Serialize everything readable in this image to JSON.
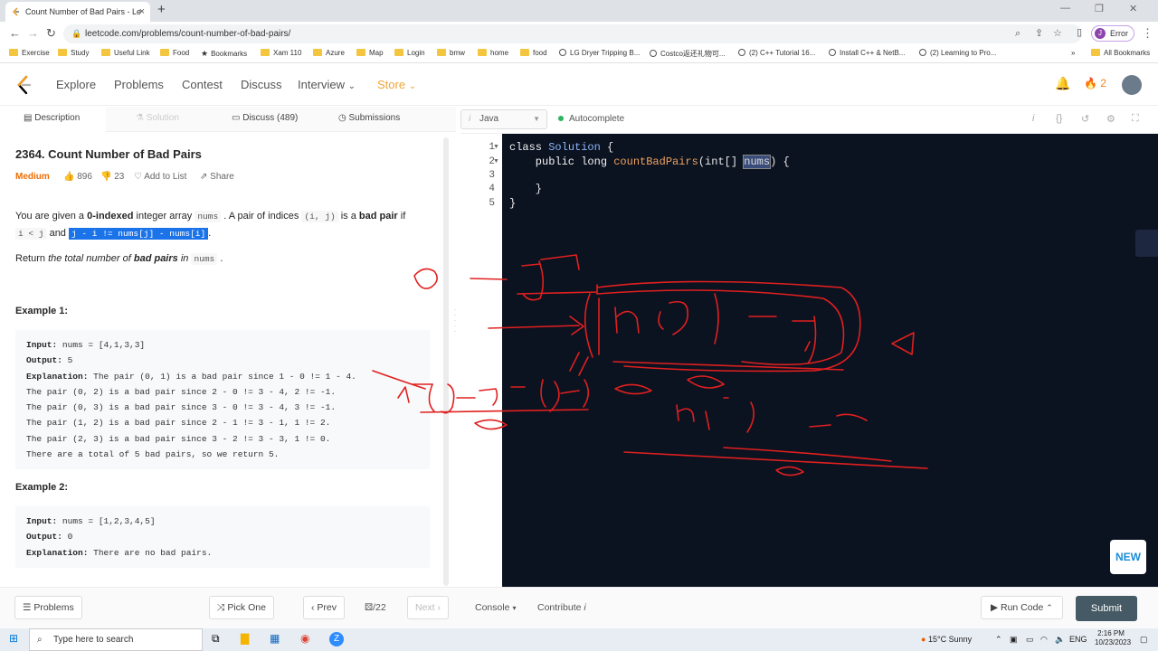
{
  "browser": {
    "tab_title": "Count Number of Bad Pairs - Le",
    "url": "leetcode.com/problems/count-number-of-bad-pairs/",
    "profile_status": "Error",
    "profile_initial": "J",
    "bookmarks": [
      "Exercise",
      "Study",
      "Useful Link",
      "Food",
      "Bookmarks",
      "Xam 110",
      "Azure",
      "Map",
      "Login",
      "bmw",
      "home",
      "food",
      "LG Dryer Tripping B...",
      "Costco返还礼物可...",
      "(2) C++ Tutorial 16...",
      "Install C++ & NetB...",
      "(2) Learning to Pro..."
    ],
    "all_bookmarks": "All Bookmarks"
  },
  "header": {
    "nav": [
      "Explore",
      "Problems",
      "Contest",
      "Discuss",
      "Interview",
      "Store"
    ],
    "streak": "2"
  },
  "left_tabs": [
    "Description",
    "Solution",
    "Discuss (489)",
    "Submissions"
  ],
  "problem": {
    "title": "2364. Count Number of Bad Pairs",
    "difficulty": "Medium",
    "likes": "896",
    "dislikes": "23",
    "add_to_list": "Add to List",
    "share": "Share",
    "p1_a": "You are given a ",
    "p1_b": "0-indexed",
    "p1_c": " integer array ",
    "p1_code1": "nums",
    "p1_d": " . A pair of indices ",
    "p1_code2": "(i, j)",
    "p1_e": " is a ",
    "p1_f": "bad pair",
    "p1_g": " if",
    "p1_code3": "i < j",
    "p1_h": " and ",
    "p1_code4": "j - i != nums[j] - nums[i]",
    "p1_i": ".",
    "p2_a": "Return ",
    "p2_b": "the total number of ",
    "p2_c": "bad pairs",
    "p2_d": " in ",
    "p2_code": "nums",
    "p2_e": " .",
    "example1_heading": "Example 1:",
    "example1": [
      {
        "label": "Input:",
        "text": " nums = [4,1,3,3]"
      },
      {
        "label": "Output:",
        "text": " 5"
      },
      {
        "label": "Explanation:",
        "text": " The pair (0, 1) is a bad pair since 1 - 0 != 1 - 4."
      },
      {
        "label": "",
        "text": "The pair (0, 2) is a bad pair since 2 - 0 != 3 - 4, 2 != -1."
      },
      {
        "label": "",
        "text": "The pair (0, 3) is a bad pair since 3 - 0 != 3 - 4, 3 != -1."
      },
      {
        "label": "",
        "text": "The pair (1, 2) is a bad pair since 2 - 1 != 3 - 1, 1 != 2."
      },
      {
        "label": "",
        "text": "The pair (2, 3) is a bad pair since 3 - 2 != 3 - 3, 1 != 0."
      },
      {
        "label": "",
        "text": "There are a total of 5 bad pairs, so we return 5."
      }
    ],
    "example2_heading": "Example 2:",
    "example2": [
      {
        "label": "Input:",
        "text": " nums = [1,2,3,4,5]"
      },
      {
        "label": "Output:",
        "text": " 0"
      },
      {
        "label": "Explanation:",
        "text": " There are no bad pairs."
      }
    ]
  },
  "editor": {
    "language": "Java",
    "autocomplete": "Autocomplete",
    "line_numbers": [
      "1",
      "2",
      "3",
      "4",
      "5"
    ],
    "l1_kw": "class ",
    "l1_cls": "Solution",
    "l1_rest": " {",
    "l2_kw": "    public long ",
    "l2_fn": "countBadPairs",
    "l2_a": "(int[] ",
    "l2_sel": "nums",
    "l2_b": ") {",
    "l4": "    }",
    "l5": "}",
    "new_badge": "NEW"
  },
  "bottom": {
    "problems": "Problems",
    "pick_one": "Pick One",
    "prev": "Prev",
    "page": "/22",
    "next": "Next",
    "console": "Console",
    "contribute": "Contribute",
    "run_code": "Run Code",
    "submit": "Submit"
  },
  "taskbar": {
    "search": "Type here to search",
    "weather": "15°C  Sunny",
    "lang": "ENG",
    "time": "2:16 PM",
    "date": "10/23/2023"
  }
}
